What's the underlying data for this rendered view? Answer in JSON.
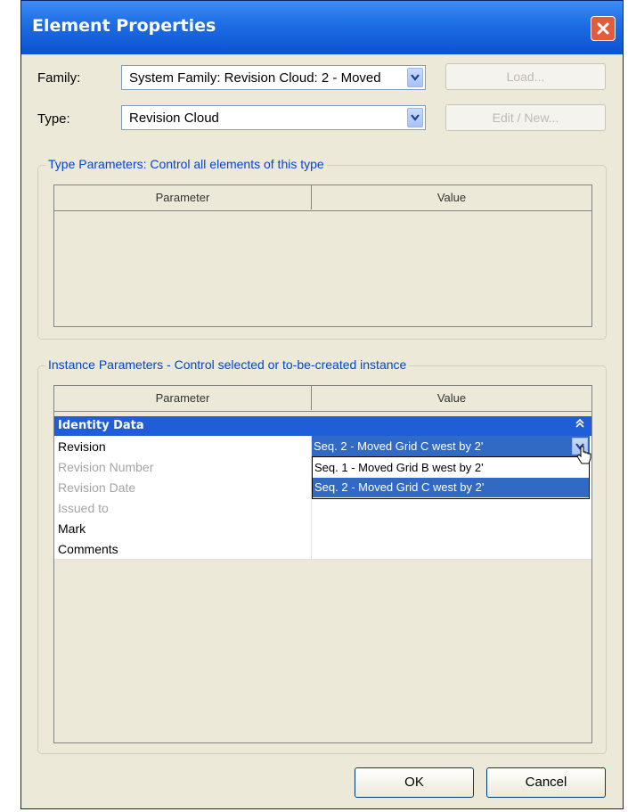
{
  "window": {
    "title": "Element Properties"
  },
  "family": {
    "label": "Family:",
    "value": "System Family: Revision Cloud: 2 - Moved",
    "load_button": "Load..."
  },
  "type": {
    "label": "Type:",
    "value": "Revision Cloud",
    "edit_button": "Edit / New..."
  },
  "type_parameters": {
    "title": "Type Parameters: Control all elements of this type",
    "columns": [
      "Parameter",
      "Value"
    ]
  },
  "instance_parameters": {
    "title": "Instance Parameters - Control selected or to-be-created instance",
    "columns": [
      "Parameter",
      "Value"
    ],
    "category": "Identity Data",
    "rows": [
      {
        "name": "Revision",
        "enabled": true
      },
      {
        "name": "Revision Number",
        "enabled": false
      },
      {
        "name": "Revision Date",
        "enabled": false
      },
      {
        "name": "Issued to",
        "enabled": false
      },
      {
        "name": "Mark",
        "enabled": true
      },
      {
        "name": "Comments",
        "enabled": true
      }
    ],
    "revision_value": "Seq. 2 - Moved Grid C west by 2'",
    "revision_options": [
      "Seq. 1 - Moved Grid B west by 2'",
      "Seq. 2 - Moved Grid C west by 2'"
    ],
    "selected_option_index": 1
  },
  "buttons": {
    "ok": "OK",
    "cancel": "Cancel"
  },
  "colors": {
    "title_bar": "#0b53d0",
    "selection": "#316ac5",
    "group_title": "#0046d5",
    "close": "#e25b3a"
  }
}
